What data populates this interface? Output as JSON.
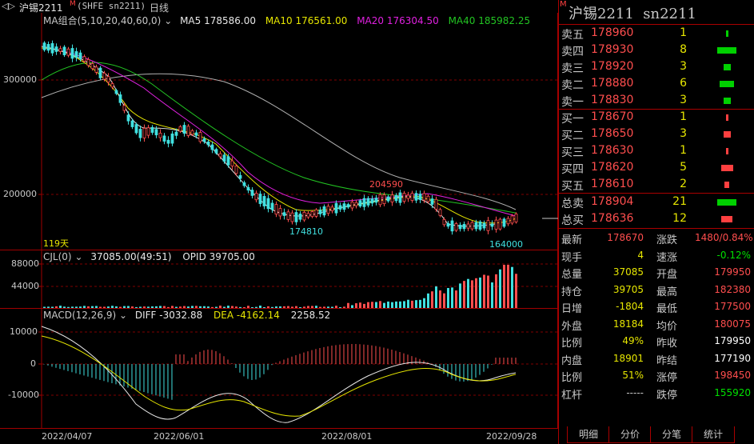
{
  "title": {
    "name": "沪锡2211",
    "flag": "M",
    "code": "(SHFE sn2211)",
    "period": "日线"
  },
  "price_pane": {
    "indicator": "MA组合(5,10,20,40,60,0)",
    "ma5": "MA5 178586.00",
    "ma10": "MA10 176561.00",
    "ma20": "MA20 176304.50",
    "ma40": "MA40 185982.25",
    "axis_ticks": [
      "300000",
      "200000"
    ],
    "days_label": "119天",
    "high_label": "204590",
    "low1_label": "174810",
    "low2_label": "164000"
  },
  "volume_pane": {
    "indicator": "CJL(0)",
    "value": "37085.00(49:51)",
    "opid": "OPID 39705.00",
    "axis_ticks": [
      "88000",
      "44000"
    ]
  },
  "macd_pane": {
    "indicator": "MACD(12,26,9)",
    "diff": "DIFF -3032.88",
    "dea": "DEA -4162.14",
    "macd": "2258.52",
    "axis_ticks": [
      "10000",
      "0",
      "-10000"
    ]
  },
  "dates": [
    "2022/04/07",
    "2022/06/01",
    "2022/08/01",
    "2022/09/28"
  ],
  "right_panel": {
    "title": "沪锡2211  sn2211",
    "flag": "M",
    "sells": [
      {
        "label": "卖五",
        "price": "178960",
        "qty": "1"
      },
      {
        "label": "卖四",
        "price": "178930",
        "qty": "8"
      },
      {
        "label": "卖三",
        "price": "178920",
        "qty": "3"
      },
      {
        "label": "卖二",
        "price": "178880",
        "qty": "6"
      },
      {
        "label": "卖一",
        "price": "178830",
        "qty": "3"
      }
    ],
    "buys": [
      {
        "label": "买一",
        "price": "178670",
        "qty": "1"
      },
      {
        "label": "买二",
        "price": "178650",
        "qty": "3"
      },
      {
        "label": "买三",
        "price": "178630",
        "qty": "1"
      },
      {
        "label": "买四",
        "price": "178620",
        "qty": "5"
      },
      {
        "label": "买五",
        "price": "178610",
        "qty": "2"
      }
    ],
    "totals": [
      {
        "label": "总卖",
        "price": "178904",
        "qty": "21"
      },
      {
        "label": "总买",
        "price": "178636",
        "qty": "12"
      }
    ],
    "stats": [
      {
        "l": "最新",
        "v": "178670",
        "vc": "#ff4e4e",
        "l2": "涨跌",
        "v2": "1480/0.84%",
        "v2c": "#ff4e4e"
      },
      {
        "l": "现手",
        "v": "4",
        "vc": "#e6e600",
        "l2": "速涨",
        "v2": "-0.12%",
        "v2c": "#00e000"
      },
      {
        "l": "总量",
        "v": "37085",
        "vc": "#e6e600",
        "l2": "开盘",
        "v2": "179950",
        "v2c": "#ff4e4e"
      },
      {
        "l": "持仓",
        "v": "39705",
        "vc": "#e6e600",
        "l2": "最高",
        "v2": "182380",
        "v2c": "#ff4e4e"
      },
      {
        "l": "日增",
        "v": "-1804",
        "vc": "#e6e600",
        "l2": "最低",
        "v2": "177500",
        "v2c": "#ff4e4e"
      },
      {
        "l": "外盘",
        "v": "18184",
        "vc": "#e6e600",
        "l2": "均价",
        "v2": "180075",
        "v2c": "#ff4e4e"
      },
      {
        "l": "比例",
        "v": "49%",
        "vc": "#e6e600",
        "l2": "昨收",
        "v2": "179950",
        "v2c": "#ffffff"
      },
      {
        "l": "内盘",
        "v": "18901",
        "vc": "#e6e600",
        "l2": "昨结",
        "v2": "177190",
        "v2c": "#ffffff"
      },
      {
        "l": "比例",
        "v": "51%",
        "vc": "#e6e600",
        "l2": "涨停",
        "v2": "198450",
        "v2c": "#ff4e4e"
      },
      {
        "l": "杠杆",
        "v": "-----",
        "vc": "#c8c8c8",
        "l2": "跌停",
        "v2": "155920",
        "v2c": "#00e000"
      }
    ],
    "tabs": [
      "明细",
      "分价",
      "分笔",
      "统计"
    ]
  }
}
